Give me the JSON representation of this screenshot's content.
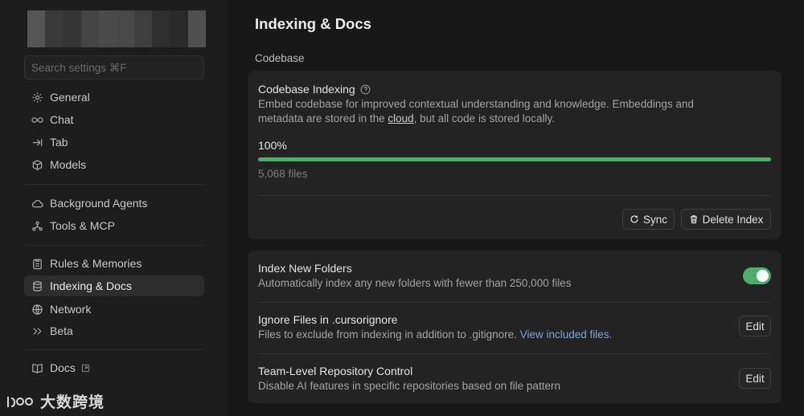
{
  "sidebar": {
    "search_placeholder": "Search settings ⌘F",
    "groups": [
      [
        {
          "label": "General",
          "icon": "gear-icon"
        },
        {
          "label": "Chat",
          "icon": "infinity-icon"
        },
        {
          "label": "Tab",
          "icon": "tab-arrow-icon"
        },
        {
          "label": "Models",
          "icon": "cube-icon"
        }
      ],
      [
        {
          "label": "Background Agents",
          "icon": "cloud-icon"
        },
        {
          "label": "Tools & MCP",
          "icon": "nodes-icon"
        }
      ],
      [
        {
          "label": "Rules & Memories",
          "icon": "clipboard-icon"
        },
        {
          "label": "Indexing & Docs",
          "icon": "database-icon",
          "active": true
        },
        {
          "label": "Network",
          "icon": "globe-icon"
        },
        {
          "label": "Beta",
          "icon": "chevrons-right-icon"
        }
      ],
      [
        {
          "label": "Docs",
          "icon": "book-icon"
        }
      ]
    ]
  },
  "watermark": {
    "text": "大数跨境"
  },
  "main": {
    "title": "Indexing & Docs",
    "section": "Codebase",
    "indexing": {
      "title": "Codebase Indexing",
      "desc_before": "Embed codebase for improved contextual understanding and knowledge. Embeddings and metadata are stored in the ",
      "desc_link": "cloud",
      "desc_after": ", but all code is stored locally.",
      "progress_label": "100%",
      "progress": 1.0,
      "files": "5,068 files",
      "sync_label": "Sync",
      "delete_label": "Delete Index"
    },
    "settings": [
      {
        "title": "Index New Folders",
        "desc": "Automatically index any new folders with fewer than 250,000 files",
        "toggle_on": true
      },
      {
        "title": "Ignore Files in .cursorignore",
        "desc": "Files to exclude from indexing in addition to .gitignore. ",
        "link": "View included files.",
        "button": "Edit"
      },
      {
        "title": "Team-Level Repository Control",
        "desc": "Disable AI features in specific repositories based on file pattern",
        "button": "Edit"
      }
    ]
  },
  "colors": {
    "accent_green": "#4caf6b",
    "link_blue": "#79a6d9"
  }
}
